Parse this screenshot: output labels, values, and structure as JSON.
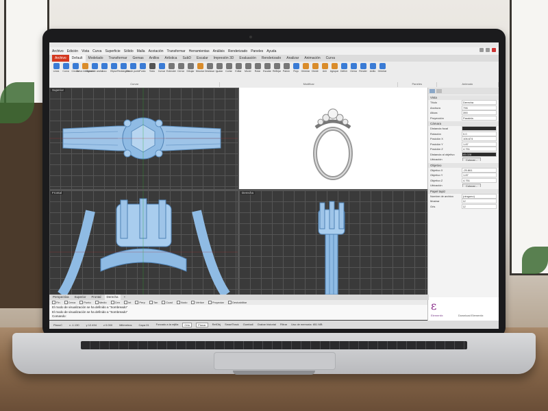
{
  "menu": [
    "Archivo",
    "Edición",
    "Vista",
    "Curva",
    "Superficie",
    "Sólido",
    "Malla",
    "Acotación",
    "Transformar",
    "Herramientas",
    "Análisis",
    "Renderizado",
    "Paneles",
    "Ayuda"
  ],
  "tabs": [
    {
      "label": "Archivo",
      "kind": "file"
    },
    {
      "label": "Default",
      "kind": "active"
    },
    {
      "label": "Modelado",
      "kind": ""
    },
    {
      "label": "Transformar",
      "kind": ""
    },
    {
      "label": "Gemas",
      "kind": ""
    },
    {
      "label": "Anillos",
      "kind": ""
    },
    {
      "label": "Artística",
      "kind": ""
    },
    {
      "label": "SubD",
      "kind": ""
    },
    {
      "label": "Escalar",
      "kind": ""
    },
    {
      "label": "Impresión 3D",
      "kind": ""
    },
    {
      "label": "Evaluación",
      "kind": ""
    },
    {
      "label": "Renderizado",
      "kind": ""
    },
    {
      "label": "Analizar",
      "kind": ""
    },
    {
      "label": "Animación",
      "kind": ""
    },
    {
      "label": "Curva",
      "kind": ""
    }
  ],
  "ribbon_tools": [
    {
      "label": "Línea",
      "color": "#3a7bd5"
    },
    {
      "label": "Curva",
      "color": "#3a7bd5"
    },
    {
      "label": "Círculo",
      "color": "#3a7bd5"
    },
    {
      "label": "Curva inteligente",
      "color": "#d98c2b"
    },
    {
      "label": "Curva de ancho",
      "color": "#3a7bd5"
    },
    {
      "label": "Arco",
      "color": "#3a7bd5"
    },
    {
      "label": "Elipse",
      "color": "#3a7bd5"
    },
    {
      "label": "Rectángulo",
      "color": "#3a7bd5"
    },
    {
      "label": "Desde punto",
      "color": "#3a7bd5"
    },
    {
      "label": "Punto",
      "color": "#3a7bd5"
    },
    {
      "label": "Texto",
      "color": "#555555"
    },
    {
      "label": "Curvar",
      "color": "#3a7bd5"
    },
    {
      "label": "Extender",
      "color": "#777777"
    },
    {
      "label": "Cerrar",
      "color": "#777777"
    },
    {
      "label": "Dibujar",
      "color": "#777777"
    },
    {
      "label": "Mezclar",
      "color": "#d98c2b"
    },
    {
      "label": "Desfasar",
      "color": "#777777"
    },
    {
      "label": "Igualar",
      "color": "#777777"
    },
    {
      "label": "Cortar",
      "color": "#777777"
    },
    {
      "label": "Editar",
      "color": "#777777"
    },
    {
      "label": "Mover",
      "color": "#777777"
    },
    {
      "label": "Rotar",
      "color": "#777777"
    },
    {
      "label": "Escalar",
      "color": "#777777"
    },
    {
      "label": "Reflejar",
      "color": "#777777"
    },
    {
      "label": "Patrón",
      "color": "#777777"
    },
    {
      "label": "Flujo",
      "color": "#3a7bd5"
    },
    {
      "label": "Orientar",
      "color": "#d98c2b"
    },
    {
      "label": "Dividir",
      "color": "#d98c2b"
    },
    {
      "label": "Unir",
      "color": "#d98c2b"
    },
    {
      "label": "Agrupar",
      "color": "#d98c2b"
    },
    {
      "label": "Definir",
      "color": "#3a7bd5"
    },
    {
      "label": "Gema",
      "color": "#3a7bd5"
    },
    {
      "label": "Render",
      "color": "#3a7bd5"
    },
    {
      "label": "Anillo",
      "color": "#3a7bd5"
    },
    {
      "label": "Orientar",
      "color": "#3a7bd5"
    }
  ],
  "ribbon_groups": [
    {
      "label": "Curvar",
      "w": 250
    },
    {
      "label": "Modificar",
      "w": 260
    },
    {
      "label": "Paneles",
      "w": 56
    },
    {
      "label": "Animado",
      "w": 90
    }
  ],
  "viewports": [
    {
      "label": "Superior",
      "id": "top"
    },
    {
      "label": "Perspectiva",
      "id": "persp"
    },
    {
      "label": "Frontal",
      "id": "front"
    },
    {
      "label": "Derecha",
      "id": "right"
    }
  ],
  "viewport_tabs": [
    "Perspectiva",
    "Superior",
    "Frontal",
    "Derecha",
    "+"
  ],
  "osnaps": [
    "Fin",
    "Cerca",
    "Punto",
    "Medio",
    "Cen",
    "Int",
    "Perp",
    "Tan",
    "Cuad",
    "Nodo",
    "Vértice",
    "Proyectar",
    "Deshabilitar"
  ],
  "command_lines": [
    "El modo de visualización se ha definido a \"Sombreado\"",
    "El modo de visualización se ha definido a \"Sombreado\"",
    "Comando:"
  ],
  "status": {
    "cplane": "PlanoC",
    "x": "x -1.130",
    "y": "y 12.494",
    "z": "z 0.000",
    "units": "Milímetros",
    "layer": "Capa 01",
    "items": [
      {
        "label": "Forzado a la rejilla",
        "on": false
      },
      {
        "label": "Orto",
        "on": true
      },
      {
        "label": "Planar",
        "on": true
      },
      {
        "label": "RefObj",
        "on": false
      },
      {
        "label": "SmartTrack",
        "on": false
      },
      {
        "label": "Gumball",
        "on": false
      },
      {
        "label": "Grabar historial",
        "on": false
      },
      {
        "label": "Filtrar",
        "on": false
      },
      {
        "label": "Uso de memoria: 651 MB",
        "on": false
      }
    ]
  },
  "panel": {
    "sections": [
      {
        "title": "Vista",
        "rows": [
          {
            "k": "Título",
            "v": "Derecha"
          },
          {
            "k": "Anchura",
            "v": "796"
          },
          {
            "k": "Altura",
            "v": "390"
          },
          {
            "k": "Proyección",
            "v": "Paralela"
          }
        ]
      },
      {
        "title": "Cámara",
        "rows": [
          {
            "k": "Distancia focal",
            "v": "",
            "dark": true
          },
          {
            "k": "Rotación",
            "v": "0.0"
          },
          {
            "k": "Posición X",
            "v": "106.674"
          },
          {
            "k": "Posición Y",
            "v": "1.87"
          },
          {
            "k": "Posición Z",
            "v": "4.751"
          },
          {
            "k": "Distancia al objetivo",
            "v": "85.028",
            "dark": true
          },
          {
            "k": "Ubicación",
            "v": "Colocar...",
            "btn": true
          }
        ]
      },
      {
        "title": "Objetivo",
        "rows": [
          {
            "k": "Objetivo X",
            "v": "-25.861"
          },
          {
            "k": "Objetivo Y",
            "v": "1.87"
          },
          {
            "k": "Objetivo Z",
            "v": "4.751"
          },
          {
            "k": "Ubicación",
            "v": "Colocar...",
            "btn": true
          }
        ]
      },
      {
        "title": "Papel tapiz",
        "rows": [
          {
            "k": "Nombre de archivo",
            "v": "(ninguno)"
          },
          {
            "k": "Mostrar",
            "v": "☑"
          },
          {
            "k": "Gris",
            "v": "☑"
          }
        ]
      }
    ]
  },
  "ad": {
    "logo": "ε",
    "brand": "Elementix",
    "download": "Download Elementix"
  }
}
